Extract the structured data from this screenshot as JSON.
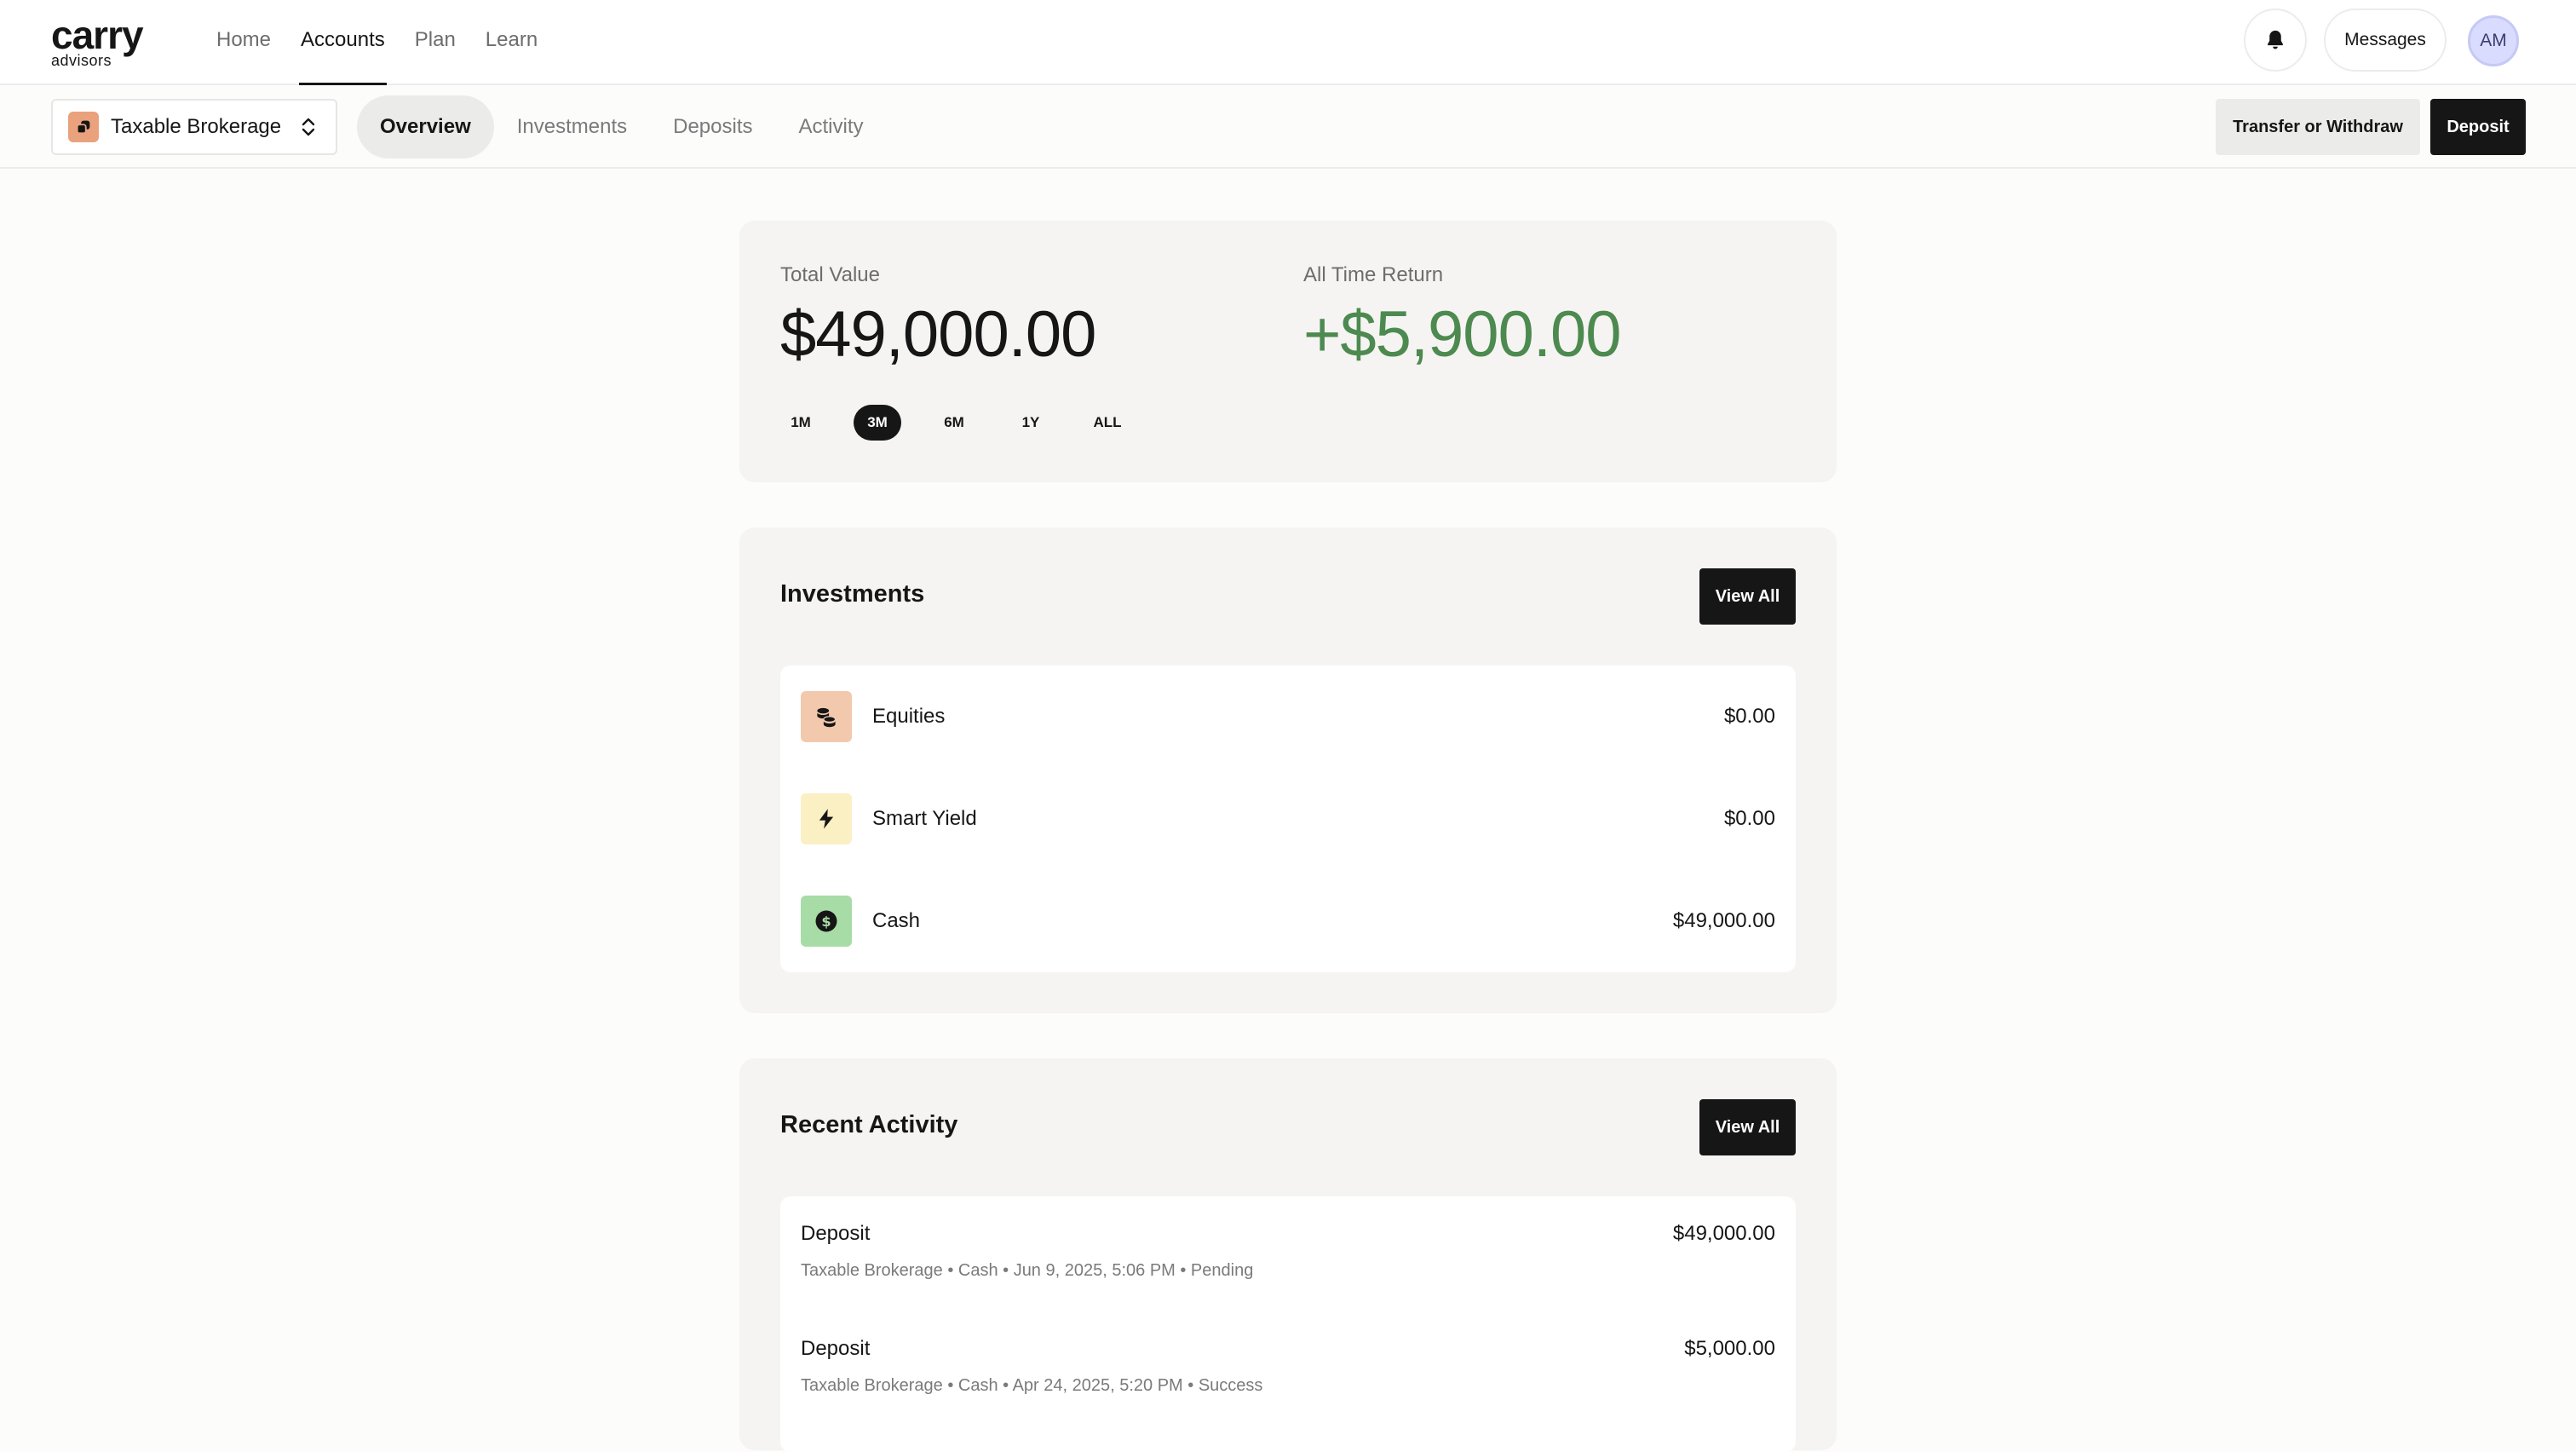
{
  "brand": {
    "name": "carry",
    "sub": "advisors"
  },
  "nav": {
    "links": [
      {
        "label": "Home",
        "active": false
      },
      {
        "label": "Accounts",
        "active": true
      },
      {
        "label": "Plan",
        "active": false
      },
      {
        "label": "Learn",
        "active": false
      }
    ],
    "messages_label": "Messages",
    "avatar_initials": "AM"
  },
  "subnav": {
    "account_label": "Taxable Brokerage",
    "tabs": [
      "Overview",
      "Investments",
      "Deposits",
      "Activity"
    ],
    "active_tab": "Overview",
    "transfer_label": "Transfer or Withdraw",
    "deposit_label": "Deposit"
  },
  "summary": {
    "total_label": "Total Value",
    "total_value": "$49,000.00",
    "return_label": "All Time Return",
    "return_value": "+$5,900.00",
    "ranges": [
      "1M",
      "3M",
      "6M",
      "1Y",
      "ALL"
    ],
    "active_range": "3M"
  },
  "investments": {
    "title": "Investments",
    "view_all": "View All",
    "items": [
      {
        "name": "Equities",
        "amount": "$0.00",
        "icon": "coins-icon",
        "color": "#f2c9ad"
      },
      {
        "name": "Smart Yield",
        "amount": "$0.00",
        "icon": "lightning-icon",
        "color": "#fbefc4"
      },
      {
        "name": "Cash",
        "amount": "$49,000.00",
        "icon": "dollar-icon",
        "color": "#a8dca6"
      }
    ]
  },
  "activity": {
    "title": "Recent Activity",
    "view_all": "View All",
    "items": [
      {
        "title": "Deposit",
        "meta": "Taxable Brokerage • Cash • Jun 9, 2025, 5:06 PM • Pending",
        "amount": "$49,000.00"
      },
      {
        "title": "Deposit",
        "meta": "Taxable Brokerage • Cash • Apr 24, 2025, 5:20 PM • Success",
        "amount": "$5,000.00"
      }
    ]
  },
  "colors": {
    "accent_green": "#4d8a4f",
    "primary_button": "#161616",
    "card_bg": "#f5f4f3"
  }
}
